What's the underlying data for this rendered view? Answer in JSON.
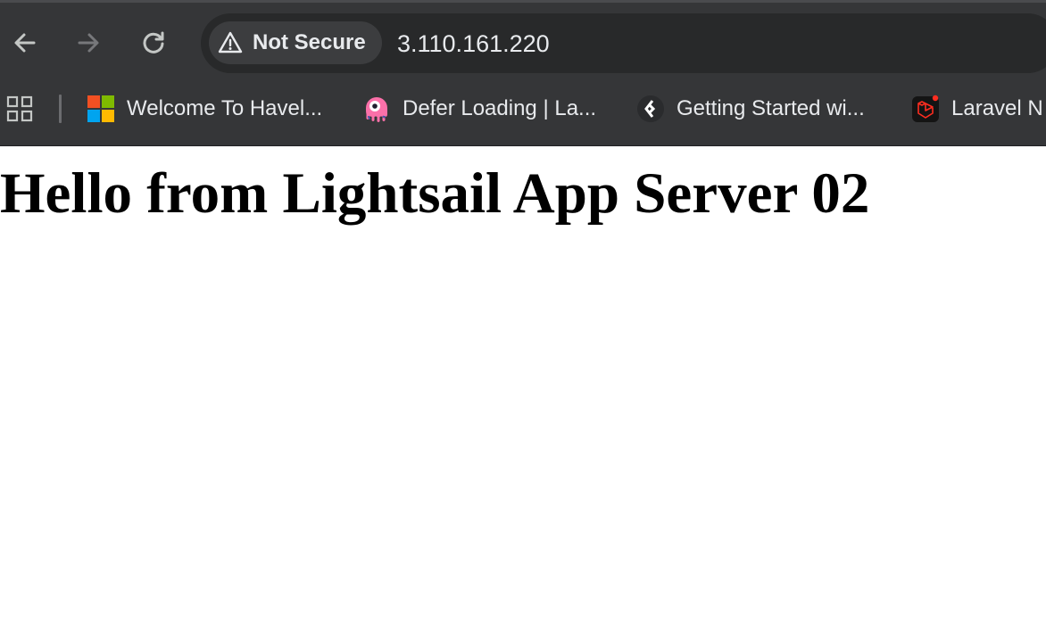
{
  "toolbar": {
    "back_icon": "arrow-left-icon",
    "forward_icon": "arrow-right-icon",
    "reload_icon": "reload-icon"
  },
  "omnibox": {
    "security_label": "Not Secure",
    "security_icon": "warning-triangle-icon",
    "url": "3.110.161.220"
  },
  "bookmarks": {
    "apps_icon": "apps-grid-icon",
    "items": [
      {
        "label": "Welcome To Havel...",
        "icon": "microsoft-logo-icon"
      },
      {
        "label": "Defer Loading | La...",
        "icon": "livewire-logo-icon"
      },
      {
        "label": "Getting Started wi...",
        "icon": "diamond-chevron-icon"
      },
      {
        "label": "Laravel N",
        "icon": "laravel-logo-icon"
      }
    ]
  },
  "page": {
    "heading": "Hello from Lightsail App Server 02"
  },
  "colors": {
    "chrome_bg": "#353638",
    "omnibox_bg": "#28292a",
    "chip_bg": "#3c3d3f",
    "text_light": "#e8eaed",
    "page_bg": "#ffffff",
    "laravel_red": "#ff2d20",
    "livewire_pink": "#fb70a9"
  }
}
